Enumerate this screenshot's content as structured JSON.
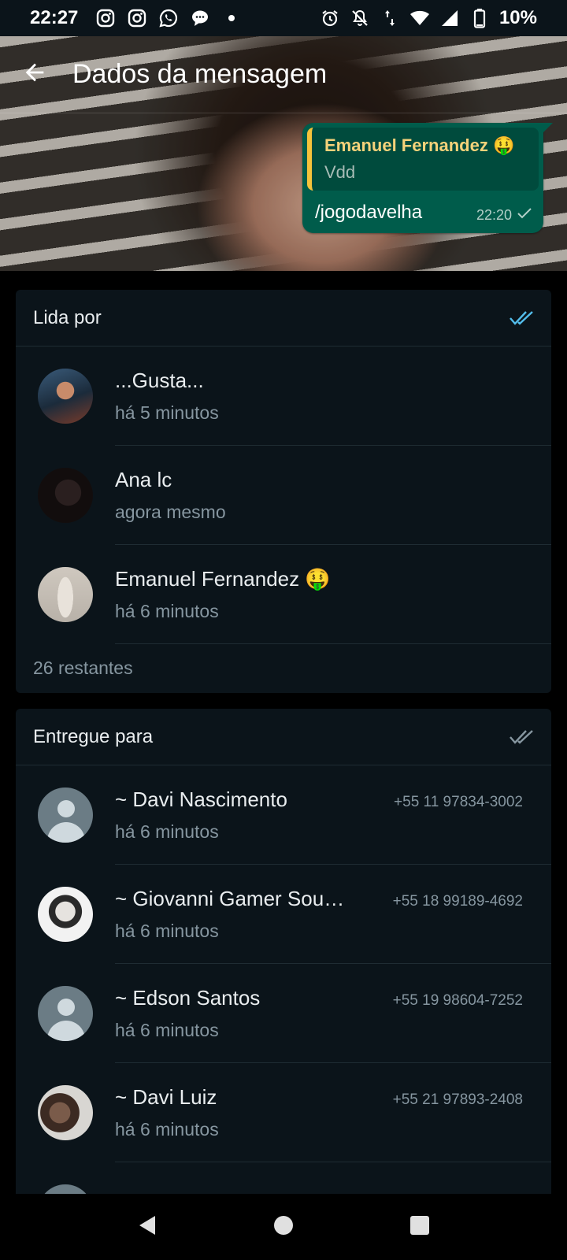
{
  "status_bar": {
    "time": "22:27",
    "battery": "10%",
    "icons_left": [
      "instagram-icon",
      "instagram-icon",
      "whatsapp-icon",
      "chat-bubble-icon",
      "dot-icon"
    ],
    "icons_right": [
      "alarm-icon",
      "notifications-off-icon",
      "data-arrows-icon",
      "wifi-icon",
      "signal-icon",
      "battery-icon"
    ]
  },
  "header": {
    "title": "Dados da mensagem",
    "back_icon": "arrow-back-icon"
  },
  "message": {
    "quote_author": "Emanuel Fernandez 🤑",
    "quote_text": "Vdd",
    "text": "/jogodavelha",
    "time": "22:20",
    "status_icon": "single-check-icon"
  },
  "read_by": {
    "title": "Lida por",
    "icon": "double-check-blue-icon",
    "accent_color": "#53bdeb",
    "items": [
      {
        "name": "...Gusta...",
        "time": "há 5 minutos"
      },
      {
        "name": "Ana lc",
        "time": "agora mesmo"
      },
      {
        "name": "Emanuel Fernandez 🤑",
        "time": "há 6 minutos"
      }
    ],
    "remaining": "26 restantes"
  },
  "delivered_to": {
    "title": "Entregue para",
    "icon": "double-check-gray-icon",
    "items": [
      {
        "name": "~ Davi Nascimento",
        "phone": "+55 11 97834-3002",
        "time": "há 6 minutos"
      },
      {
        "name": "~ Giovanni Gamer Sou…",
        "phone": "+55 18 99189-4692",
        "time": "há 6 minutos"
      },
      {
        "name": "~ Edson Santos",
        "phone": "+55 19 98604-7252",
        "time": "há 6 minutos"
      },
      {
        "name": "~ Davi Luiz",
        "phone": "+55 21 97893-2408",
        "time": "há 6 minutos"
      }
    ]
  },
  "colors": {
    "background": "#000000",
    "card": "#0b141a",
    "bubble": "#005c4b",
    "quote_bar": "#f5c33b",
    "secondary_text": "#8696a0"
  },
  "navigation": {
    "icons": [
      "nav-back-icon",
      "nav-home-icon",
      "nav-recents-icon"
    ]
  }
}
